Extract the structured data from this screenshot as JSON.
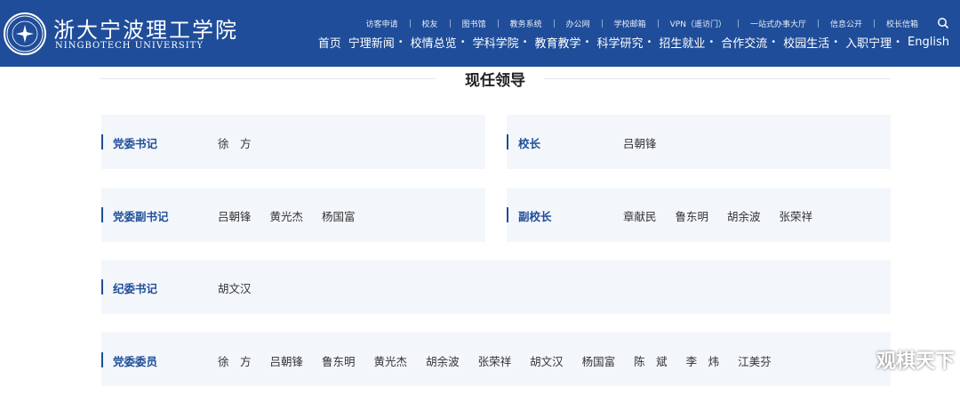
{
  "header": {
    "logo_cn": "浙大宁波理工学院",
    "logo_en": "NINGBOTECH UNIVERSITY",
    "utility_links": [
      "访客申请",
      "校友",
      "图书馆",
      "教务系统",
      "办公网",
      "学校邮箱",
      "VPN（遥访门）",
      "一站式办事大厅",
      "信息公开",
      "校长信箱"
    ],
    "main_nav": [
      "首页",
      "宁理新闻",
      "校情总览",
      "学科学院",
      "教育教学",
      "科学研究",
      "招生就业",
      "合作交流",
      "校园生活",
      "入职宁理",
      "English"
    ]
  },
  "section": {
    "title": "现任领导"
  },
  "leaders": {
    "party_secretary": {
      "role": "党委书记",
      "names": [
        "徐　方"
      ]
    },
    "president": {
      "role": "校长",
      "names": [
        "吕朝锋"
      ]
    },
    "deputy_party_secretary": {
      "role": "党委副书记",
      "names": [
        "吕朝锋",
        "黄光杰",
        "杨国富"
      ]
    },
    "vice_president": {
      "role": "副校长",
      "names": [
        "章献民",
        "鲁东明",
        "胡余波",
        "张荣祥"
      ]
    },
    "discipline_secretary": {
      "role": "纪委书记",
      "names": [
        "胡文汉"
      ]
    },
    "committee_members": {
      "role": "党委委员",
      "names": [
        "徐　方",
        "吕朝锋",
        "鲁东明",
        "黄光杰",
        "胡余波",
        "张荣祥",
        "胡文汉",
        "杨国富",
        "陈　斌",
        "李　炜",
        "江美芬"
      ]
    }
  },
  "watermark": "观棋天下",
  "colors": {
    "brand_blue": "#1f4d99",
    "card_bg": "#f3f7fb"
  }
}
